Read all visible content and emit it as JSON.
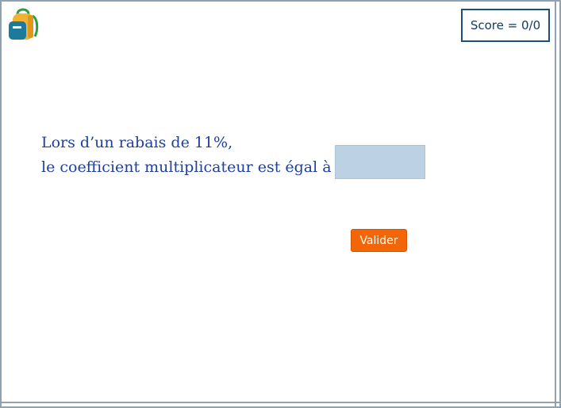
{
  "header": {
    "logo_icon": "backpack-icon",
    "score_label": "Score = 0/0"
  },
  "question": {
    "line1": "Lors d’un rabais de 11%,",
    "line2": "le coefficient multiplicateur est égal à",
    "answer_value": ""
  },
  "actions": {
    "validate_label": "Valider"
  },
  "colors": {
    "question_text": "#1f3fa0",
    "input_bg": "#bdd1e4",
    "button_bg": "#f26608",
    "score_border": "#1b4f7a",
    "frame_border": "#8fa1b5"
  }
}
